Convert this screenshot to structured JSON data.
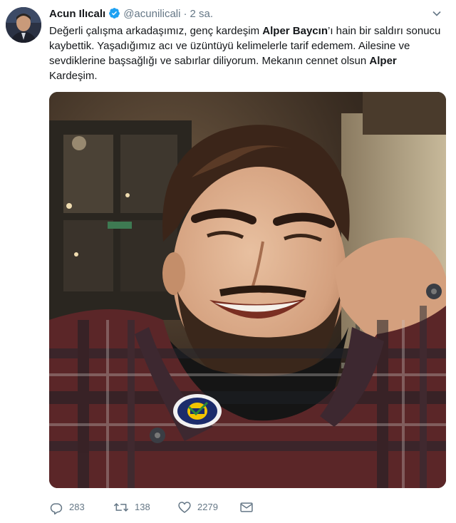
{
  "author": {
    "name": "Acun Ilıcalı",
    "handle": "@acunilicali",
    "separator": "·",
    "time": "2 sa."
  },
  "tweet": {
    "t1": "Değerli çalışma arkadaşımız, genç kardeşim ",
    "b1": "Alper Baycın",
    "t2": "’ı hain bir saldırı sonucu kaybettik. Yaşadığımız acı ve üzüntüyü kelimelerle tarif edemem. Ailesine ve sevdiklerine başsağlığı ve sabırlar diliyorum. Mekanın cennet olsun ",
    "b2": "Alper",
    "t3": " Kardeşim."
  },
  "stats": {
    "replies": "283",
    "retweets": "138",
    "likes": "2279"
  },
  "colors": {
    "text": "#14171a",
    "muted": "#657786",
    "verified": "#1da1f2"
  },
  "icons": [
    "verified-badge-icon",
    "caret-down-icon",
    "reply-icon",
    "retweet-icon",
    "like-icon",
    "message-icon"
  ]
}
